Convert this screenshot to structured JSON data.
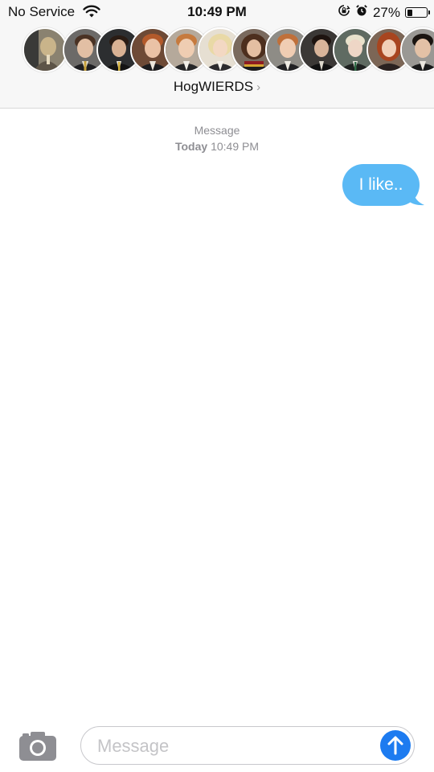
{
  "status_bar": {
    "carrier": "No Service",
    "time": "10:49 PM",
    "battery_percent_label": "27%",
    "battery_level": 0.27
  },
  "header": {
    "group_name": "HogWIERDS",
    "chevron": "›",
    "avatar_count": 12
  },
  "conversation": {
    "service_label": "Message",
    "date_label": "Today",
    "time_label": "10:49 PM",
    "messages": [
      {
        "direction": "outgoing",
        "text": "I like..",
        "color": "#5ab9f5"
      }
    ]
  },
  "composer": {
    "placeholder": "Message",
    "camera_icon": "camera-icon",
    "send_icon": "send-arrow-icon",
    "send_color": "#1d7bf0"
  }
}
